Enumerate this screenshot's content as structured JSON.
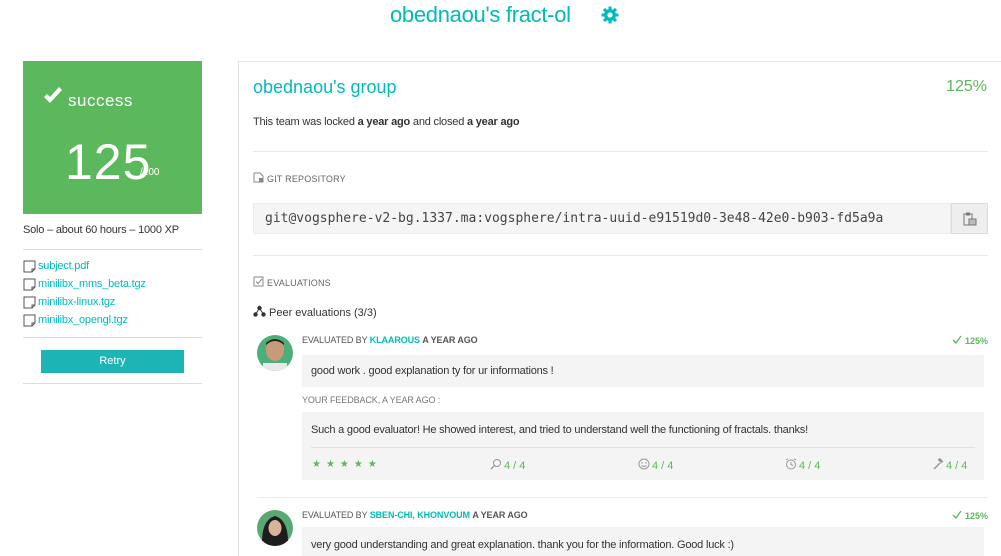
{
  "header": {
    "title": "obednaou's fract-ol",
    "icon": "gear-icon"
  },
  "sidebar": {
    "status": "success",
    "score": "125",
    "score_max": "/100",
    "meta": "Solo – about 60 hours – 1000 XP",
    "files": [
      "subject.pdf",
      "minilibx_mms_beta.tgz",
      "minilibx-linux.tgz",
      "minilibx_opengl.tgz"
    ],
    "retry_label": "Retry"
  },
  "team": {
    "name": "obednaou's group",
    "final_mark": "125%",
    "locked_prefix": "This team was locked",
    "locked_when": "a year ago",
    "closed_text": "and closed",
    "closed_when": "a year ago"
  },
  "git": {
    "section_label": "GIT REPOSITORY",
    "url": "git@vogsphere-v2-bg.1337.ma:vogsphere/intra-uuid-e91519d0-3e48-42e0-b903-fd5a9a"
  },
  "evaluations": {
    "section_label": "EVALUATIONS",
    "peer_label": "Peer evaluations (3/3)",
    "items": [
      {
        "evaluated_by": "EVALUATED BY",
        "evaluator": "KLAAROUS",
        "when": "A YEAR AGO",
        "mark": "125%",
        "comment": "good work . good explanation ty for ur informations !",
        "feedback_label": "YOUR FEEDBACK, A YEAR AGO :",
        "feedback": "Such a good evaluator! He showed interest, and tried to understand well the functioning of fractals. thanks!",
        "stars": "★★★★★",
        "rating_1": "4 / 4",
        "rating_2": "4 / 4",
        "rating_3": "4 / 4",
        "rating_4": "4 / 4"
      },
      {
        "evaluated_by": "EVALUATED BY",
        "evaluator": "SBEN-CHI, KHONVOUM",
        "when": "A YEAR AGO",
        "mark": "125%",
        "comment": "very good understanding and great explanation. thank you for the information. Good luck :)"
      }
    ]
  },
  "colors": {
    "accent": "#00babc",
    "success": "#5cb85c",
    "retry": "#1db4b6"
  }
}
